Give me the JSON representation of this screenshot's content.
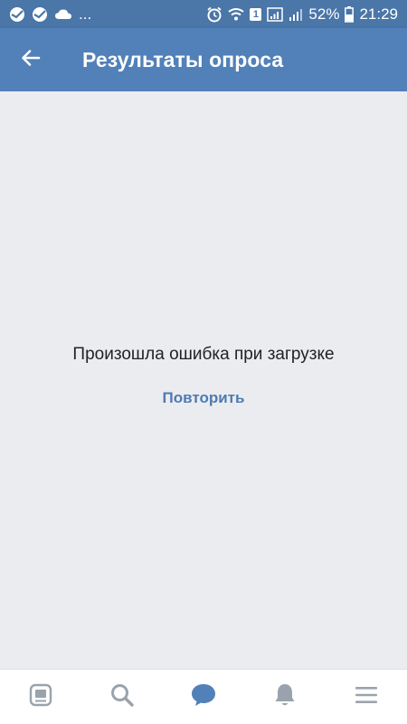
{
  "status_bar": {
    "left_icons": [
      "sberbank-icon",
      "sberbank-icon",
      "cloud-icon"
    ],
    "more_indicator": "...",
    "right_icons": [
      "alarm-icon",
      "wifi-icon",
      "sim-icon",
      "signal-icon",
      "signal-icon",
      "battery-icon"
    ],
    "sim_number": "1",
    "battery_percent": "52%",
    "time": "21:29"
  },
  "header": {
    "back_icon": "arrow-left-icon",
    "title": "Результаты опроса"
  },
  "main": {
    "error_message": "Произошла ошибка при загрузке",
    "retry_label": "Повторить"
  },
  "bottom_nav": {
    "items": [
      {
        "icon": "news-icon",
        "active": false
      },
      {
        "icon": "search-icon",
        "active": false
      },
      {
        "icon": "messages-icon",
        "active": true
      },
      {
        "icon": "notifications-icon",
        "active": false
      },
      {
        "icon": "menu-icon",
        "active": false
      }
    ]
  },
  "colors": {
    "statusbar": "#4a76a8",
    "header": "#5181b8",
    "background": "#ebecf0",
    "accent": "#5181b8",
    "nav_inactive": "#9aa3ad",
    "link": "#4f7bb0"
  }
}
